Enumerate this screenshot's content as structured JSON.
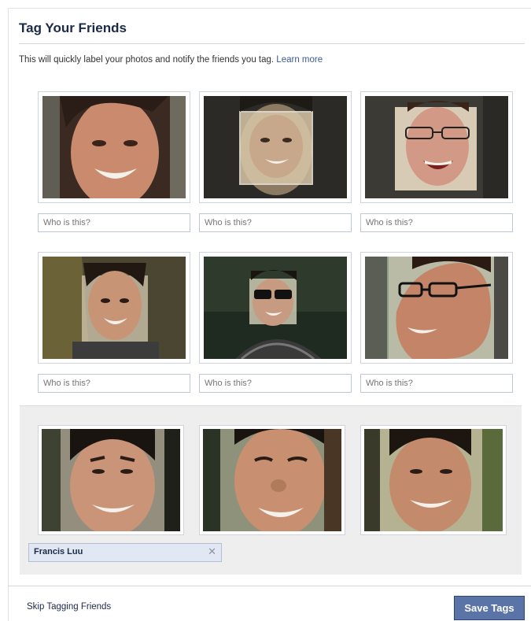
{
  "dialog": {
    "title": "Tag Your Friends",
    "subtitle": "This will quickly label your photos and notify the friends you tag.",
    "learn_more": "Learn more"
  },
  "faces": [
    {
      "placeholder": "Who is this?"
    },
    {
      "placeholder": "Who is this?"
    },
    {
      "placeholder": "Who is this?"
    },
    {
      "placeholder": "Who is this?"
    },
    {
      "placeholder": "Who is this?"
    },
    {
      "placeholder": "Who is this?"
    }
  ],
  "selected_group": {
    "tag_name": "Francis Luu",
    "remove_symbol": "✕"
  },
  "footer": {
    "skip_label": "Skip Tagging Friends",
    "save_label": "Save Tags"
  },
  "colors": {
    "link": "#3b5998",
    "title": "#1c2a47",
    "save_button": "#5b74a8"
  }
}
